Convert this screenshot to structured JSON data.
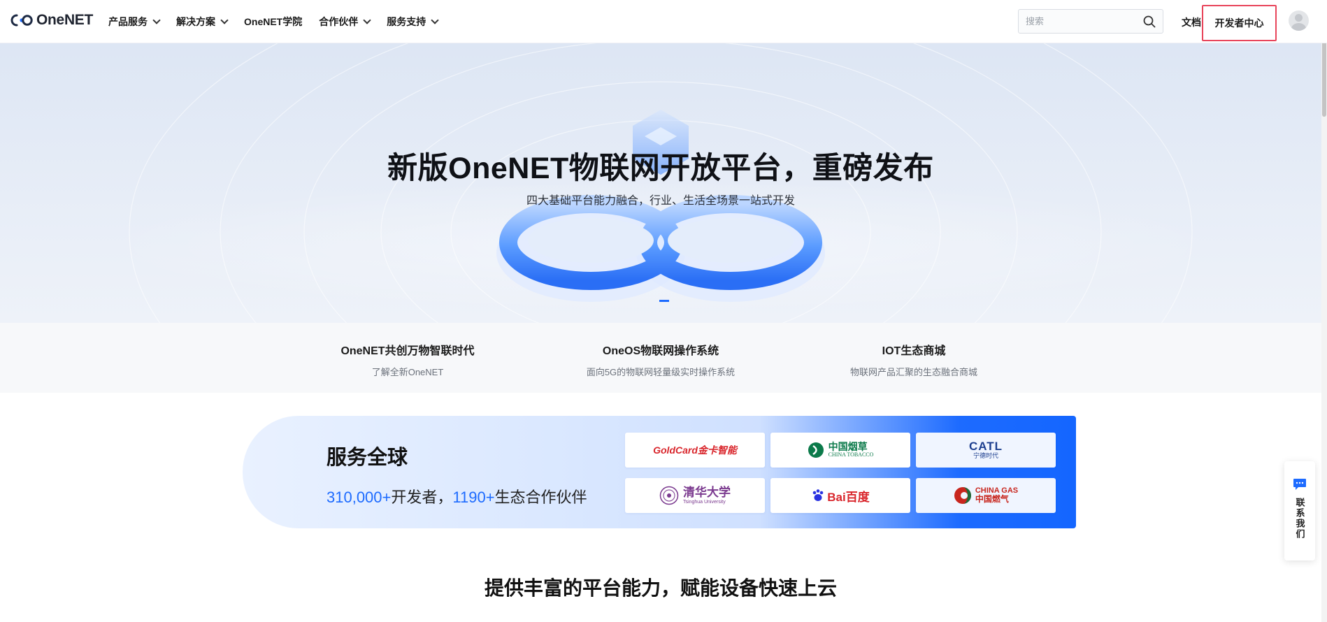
{
  "brand": {
    "logo_text": "OneNET"
  },
  "nav": [
    {
      "label": "产品服务",
      "dropdown": true
    },
    {
      "label": "解决方案",
      "dropdown": true
    },
    {
      "label": "OneNET学院",
      "dropdown": false
    },
    {
      "label": "合作伙伴",
      "dropdown": true
    },
    {
      "label": "服务支持",
      "dropdown": true
    }
  ],
  "header": {
    "search_placeholder": "搜索",
    "docs_label": "文档",
    "dev_center_label": "开发者中心"
  },
  "hero": {
    "title": "新版OneNET物联网开放平台，重磅发布",
    "subtitle": "四大基础平台能力融合，行业、生活全场景一站式开发"
  },
  "features": [
    {
      "title": "OneNET共创万物智联时代",
      "desc": "了解全新OneNET"
    },
    {
      "title": "OneOS物联网操作系统",
      "desc": "面向5G的物联网轻量级实时操作系统"
    },
    {
      "title": "IOT生态商城",
      "desc": "物联网产品汇聚的生态融合商城"
    }
  ],
  "global": {
    "title": "服务全球",
    "dev_count": "310,000+",
    "dev_label": "开发者，",
    "partner_count": "1190+",
    "partner_label": "生态合作伙伴"
  },
  "partners": [
    {
      "name": "GoldCard金卡智能",
      "color": "#d9262c"
    },
    {
      "name": "中国烟草",
      "sub": "CHINA TOBACCO",
      "color": "#0b7a4a"
    },
    {
      "name": "CATL",
      "sub": "宁德时代",
      "color": "#1d3f8f"
    },
    {
      "name": "清华大学",
      "sub": "Tsinghua University",
      "color": "#7b3a8f"
    },
    {
      "name": "Bai百度",
      "color": "#d9262c"
    },
    {
      "name": "CHINA GAS",
      "sub": "中国燃气",
      "color": "#c8261e"
    }
  ],
  "section": {
    "title": "提供丰富的平台能力，赋能设备快速上云"
  },
  "contact": {
    "label": "联系我们"
  },
  "colors": {
    "accent": "#1d6bff",
    "highlight_border": "#e8455b"
  }
}
